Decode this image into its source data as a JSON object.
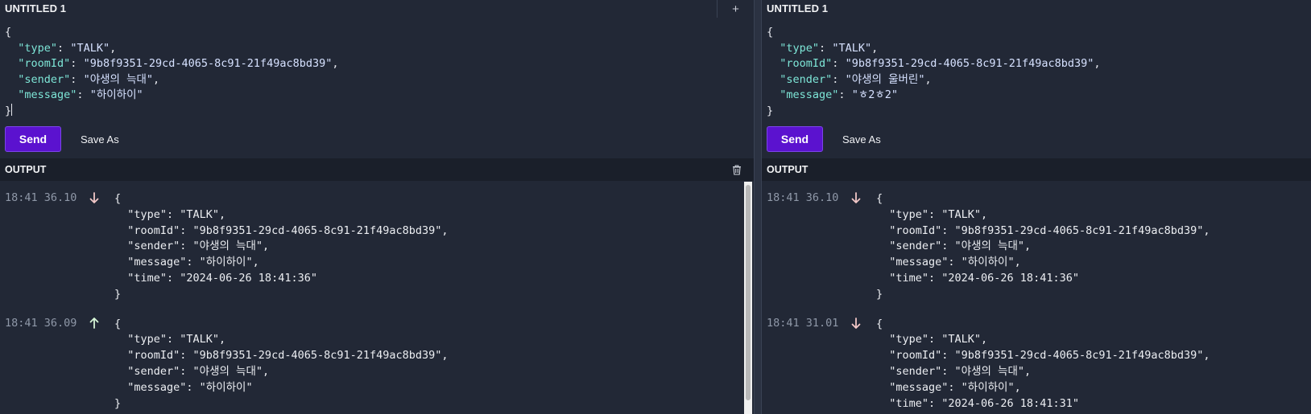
{
  "left": {
    "tab_title": "UNTITLED 1",
    "add_tab_label": "+",
    "editor_lines": [
      {
        "prefix": "{",
        "key": "",
        "value": "",
        "suffix": ""
      },
      {
        "prefix": "  ",
        "key": "\"type\"",
        "value": "\"TALK\"",
        "suffix": ","
      },
      {
        "prefix": "  ",
        "key": "\"roomId\"",
        "value": "\"9b8f9351-29cd-4065-8c91-21f49ac8bd39\"",
        "suffix": ","
      },
      {
        "prefix": "  ",
        "key": "\"sender\"",
        "value": "\"야생의 늑대\"",
        "suffix": ","
      },
      {
        "prefix": "  ",
        "key": "\"message\"",
        "value": "\"하이하이\"",
        "suffix": ""
      },
      {
        "prefix": "}",
        "key": "",
        "value": "",
        "suffix": ""
      }
    ],
    "send_label": "Send",
    "save_as_label": "Save As",
    "output_title": "OUTPUT",
    "entries": [
      {
        "time": "18:41 36.10",
        "direction": "down",
        "lines": [
          "{",
          "  \"type\": \"TALK\",",
          "  \"roomId\": \"9b8f9351-29cd-4065-8c91-21f49ac8bd39\",",
          "  \"sender\": \"야생의 늑대\",",
          "  \"message\": \"하이하이\",",
          "  \"time\": \"2024-06-26 18:41:36\"",
          "}"
        ]
      },
      {
        "time": "18:41 36.09",
        "direction": "up",
        "lines": [
          "{",
          "  \"type\": \"TALK\",",
          "  \"roomId\": \"9b8f9351-29cd-4065-8c91-21f49ac8bd39\",",
          "  \"sender\": \"야생의 늑대\",",
          "  \"message\": \"하이하이\"",
          "}"
        ]
      }
    ]
  },
  "right": {
    "tab_title": "UNTITLED 1",
    "editor_lines": [
      {
        "prefix": "{",
        "key": "",
        "value": "",
        "suffix": ""
      },
      {
        "prefix": "  ",
        "key": "\"type\"",
        "value": "\"TALK\"",
        "suffix": ","
      },
      {
        "prefix": "  ",
        "key": "\"roomId\"",
        "value": "\"9b8f9351-29cd-4065-8c91-21f49ac8bd39\"",
        "suffix": ","
      },
      {
        "prefix": "  ",
        "key": "\"sender\"",
        "value": "\"야생의 울버린\"",
        "suffix": ","
      },
      {
        "prefix": "  ",
        "key": "\"message\"",
        "value": "\"ㅎ2ㅎ2\"",
        "suffix": ""
      },
      {
        "prefix": "}",
        "key": "",
        "value": "",
        "suffix": ""
      }
    ],
    "send_label": "Send",
    "save_as_label": "Save As",
    "output_title": "OUTPUT",
    "entries": [
      {
        "time": "18:41 36.10",
        "direction": "down",
        "lines": [
          "{",
          "  \"type\": \"TALK\",",
          "  \"roomId\": \"9b8f9351-29cd-4065-8c91-21f49ac8bd39\",",
          "  \"sender\": \"야생의 늑대\",",
          "  \"message\": \"하이하이\",",
          "  \"time\": \"2024-06-26 18:41:36\"",
          "}"
        ]
      },
      {
        "time": "18:41 31.01",
        "direction": "down",
        "lines": [
          "{",
          "  \"type\": \"TALK\",",
          "  \"roomId\": \"9b8f9351-29cd-4065-8c91-21f49ac8bd39\",",
          "  \"sender\": \"야생의 늑대\",",
          "  \"message\": \"하이하이\",",
          "  \"time\": \"2024-06-26 18:41:31\"",
          "}"
        ]
      }
    ]
  },
  "colors": {
    "accent": "#5b12cf",
    "key": "#7ee7d8",
    "string": "#d6e1ff",
    "muted": "#8f98a8"
  },
  "icons": {
    "add": "plus-icon",
    "trash": "trash-icon",
    "down": "arrow-down-icon",
    "up": "arrow-up-icon"
  }
}
